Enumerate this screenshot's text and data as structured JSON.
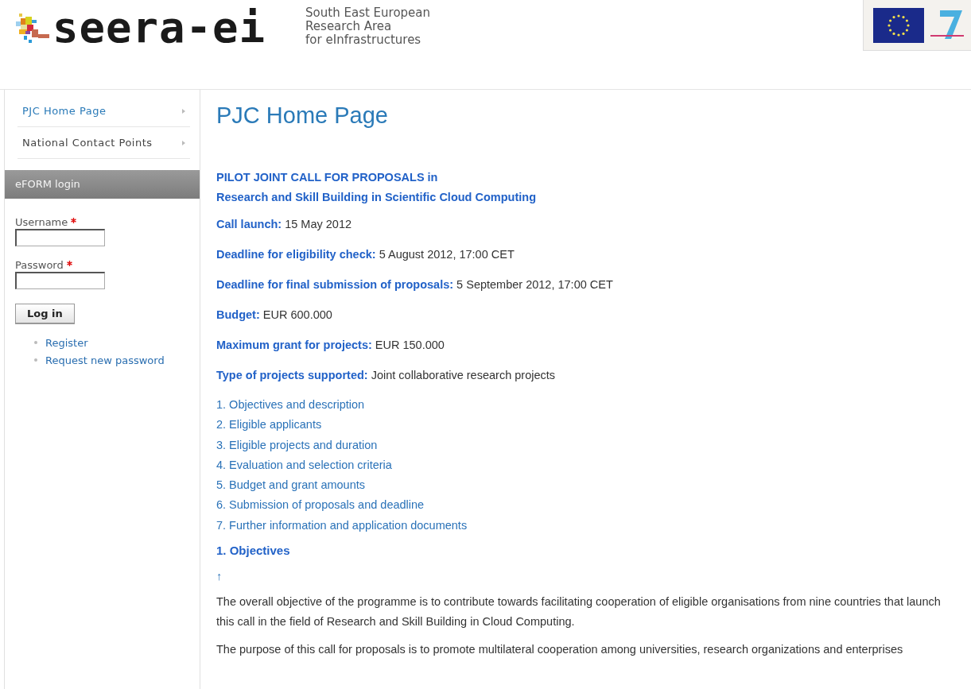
{
  "header": {
    "logo_text": "seera-ei",
    "tagline": [
      "South East European",
      "Research Area",
      "for eInfrastructures"
    ]
  },
  "sidebar": {
    "menu": [
      {
        "label": "PJC Home Page",
        "selected": true
      },
      {
        "label": "National Contact Points",
        "selected": false
      }
    ],
    "login": {
      "title": "eFORM login",
      "fields": [
        {
          "label": "Username",
          "required": true
        },
        {
          "label": "Password",
          "required": true
        }
      ],
      "button": "Log in",
      "links": [
        "Register",
        "Request new password"
      ]
    }
  },
  "main": {
    "title": "PJC Home Page",
    "call_title": [
      "PILOT JOINT CALL FOR PROPOSALS in",
      "Research and Skill Building in Scientific Cloud Computing"
    ],
    "facts": [
      {
        "label": "Call launch:",
        "value": "15 May 2012"
      },
      {
        "label": "Deadline for eligibility check:",
        "value": "5 August 2012, 17:00 CET"
      },
      {
        "label": "Deadline for final submission of proposals:",
        "value": "5 September 2012, 17:00 CET"
      },
      {
        "label": "Budget:",
        "value": "EUR 600.000"
      },
      {
        "label": "Maximum grant for projects:",
        "value": "EUR 150.000"
      },
      {
        "label": "Type of projects supported:",
        "value": "Joint collaborative research projects"
      }
    ],
    "toc": [
      "1. Objectives and description",
      "2. Eligible applicants",
      "3. Eligible projects and duration",
      "4. Evaluation and selection criteria",
      "5. Budget and grant amounts",
      "6. Submission of proposals and deadline",
      "7. Further information and application documents"
    ],
    "section_heading": "1. Objectives",
    "top_link": "↑",
    "paragraphs": [
      "The overall objective of the programme is to contribute towards facilitating cooperation of eligible organisations from nine  countries that launch this call in the field of Research  and Skill Building in Cloud Computing.",
      "The purpose of this call for proposals is to promote multilateral cooperation among universities, research organizations and enterprises"
    ]
  }
}
